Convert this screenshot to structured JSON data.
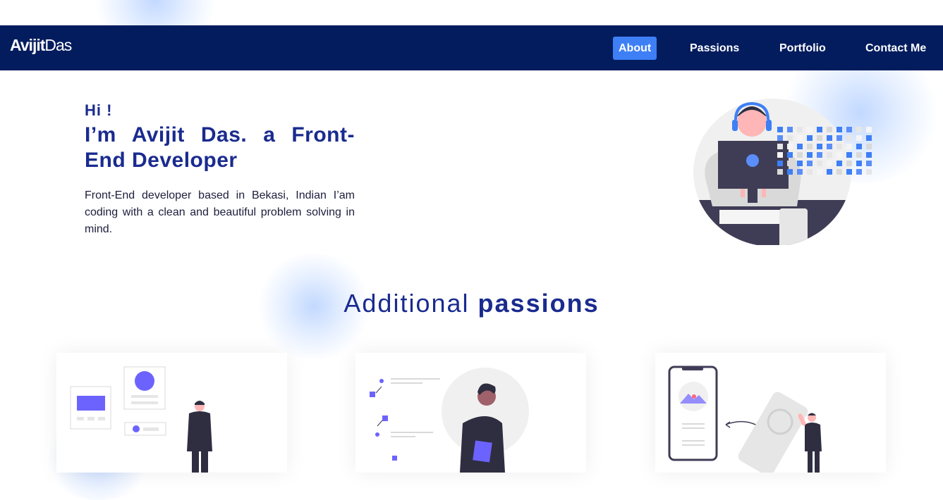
{
  "navbar": {
    "brand_bold": "Avijit",
    "brand_regular": "Das",
    "items": [
      {
        "label": "About",
        "active": true
      },
      {
        "label": "Passions",
        "active": false
      },
      {
        "label": "Portfolio",
        "active": false
      },
      {
        "label": "Contact Me",
        "active": false
      }
    ]
  },
  "hero": {
    "greeting": "Hi !",
    "title": "I’m Avijit Das. a Front-End Developer",
    "description": "Front-End developer based in Bekasi, Indian I’am coding with a clean and beautiful problem solving in mind.",
    "illustration": "developer-at-laptop-illustration"
  },
  "passions": {
    "title_regular": "Additional",
    "title_bold": "passions",
    "cards": [
      {
        "illustration": "ui-design-illustration"
      },
      {
        "illustration": "workflow-checklist-illustration"
      },
      {
        "illustration": "mobile-app-illustration"
      }
    ]
  },
  "colors": {
    "navbar_bg": "#021c5e",
    "active_nav": "#3e7ff5",
    "heading": "#1a2b8f",
    "accent_purple": "#6c63ff"
  }
}
